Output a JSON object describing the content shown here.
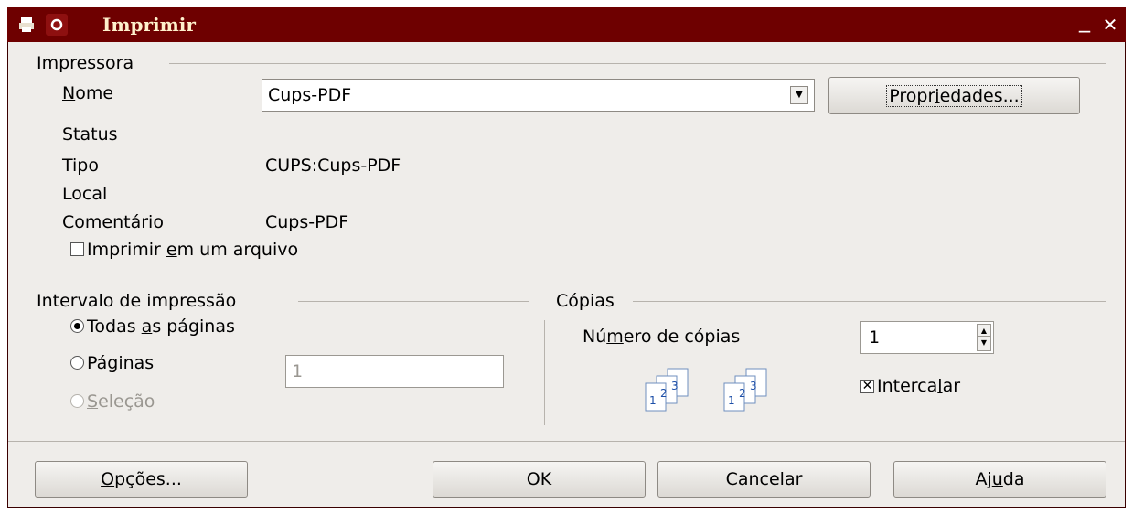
{
  "window": {
    "title": "Imprimir",
    "minimize_label": "_",
    "close_label": "✕"
  },
  "printer": {
    "section_label": "Impressora",
    "name_label_underlined": "N",
    "name_label_rest": "ome",
    "selected_printer": "Cups-PDF",
    "properties_button": {
      "pre": "Propr",
      "ul": "i",
      "post": "edades..."
    },
    "status_label": "Status",
    "status_value": "",
    "type_label": "Tipo",
    "type_value": "CUPS:Cups-PDF",
    "location_label": "Local",
    "location_value": "",
    "comment_label": "Comentário",
    "comment_value": "Cups-PDF",
    "print_to_file": {
      "pre": "Imprimir ",
      "ul": "e",
      "post": "m um arquivo",
      "checked": false
    }
  },
  "range": {
    "section_label": "Intervalo de impressão",
    "all_pages": {
      "pre": "Todas ",
      "ul": "a",
      "post": "s páginas",
      "selected": true
    },
    "pages": {
      "pre": "Pá",
      "ul": "g",
      "post": "inas",
      "selected": false
    },
    "pages_value": "1",
    "selection": {
      "pre": "",
      "ul": "S",
      "post": "eleção",
      "selected": false,
      "disabled": true
    }
  },
  "copies": {
    "section_label": "Cópias",
    "number_label": {
      "pre": "Nú",
      "ul": "m",
      "post": "ero de cópias"
    },
    "number_value": "1",
    "collate": {
      "pre": "Interca",
      "ul": "l",
      "post": "ar",
      "checked": true
    },
    "icon_digits": [
      "1",
      "2",
      "3"
    ]
  },
  "buttons": {
    "options": {
      "pre": "",
      "ul": "O",
      "post": "pções..."
    },
    "ok": "OK",
    "cancel": "Cancelar",
    "help": {
      "pre": "Aj",
      "ul": "u",
      "post": "da"
    }
  },
  "colors": {
    "titlebar": "#6e0000",
    "dialog_bg": "#efedea"
  }
}
